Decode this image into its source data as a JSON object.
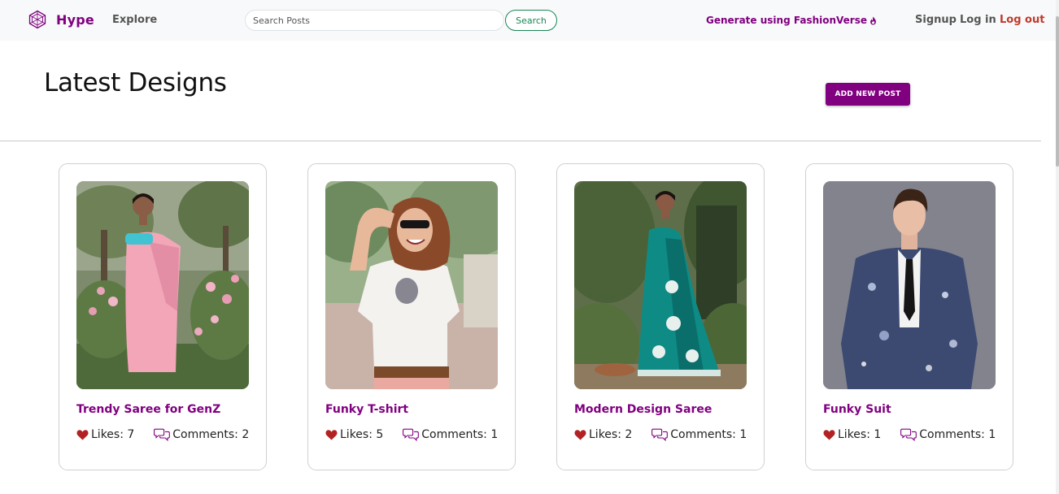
{
  "nav": {
    "brand": "Hype",
    "explore": "Explore",
    "search_placeholder": "Search Posts",
    "search_button": "Search",
    "generate": "Generate using FashionVerse",
    "signup": "Signup",
    "login": "Log in",
    "logout": "Log out"
  },
  "header": {
    "title": "Latest Designs",
    "add_button": "ADD NEW POST"
  },
  "posts": [
    {
      "title": "Trendy Saree for GenZ",
      "likes": "Likes: 7",
      "comments": "Comments: 2"
    },
    {
      "title": "Funky T-shirt",
      "likes": "Likes: 5",
      "comments": "Comments: 1"
    },
    {
      "title": "Modern Design Saree",
      "likes": "Likes: 2",
      "comments": "Comments: 1"
    },
    {
      "title": "Funky Suit",
      "likes": "Likes: 1",
      "comments": "Comments: 1"
    }
  ],
  "icons": {
    "brand": "hexagon-logo-icon",
    "generate": "flame-icon",
    "likes": "heart-icon",
    "comments": "chat-bubbles-icon"
  },
  "colors": {
    "brand": "#800080",
    "search": "#198754",
    "logout": "#c0392b",
    "heart": "#b22222"
  }
}
